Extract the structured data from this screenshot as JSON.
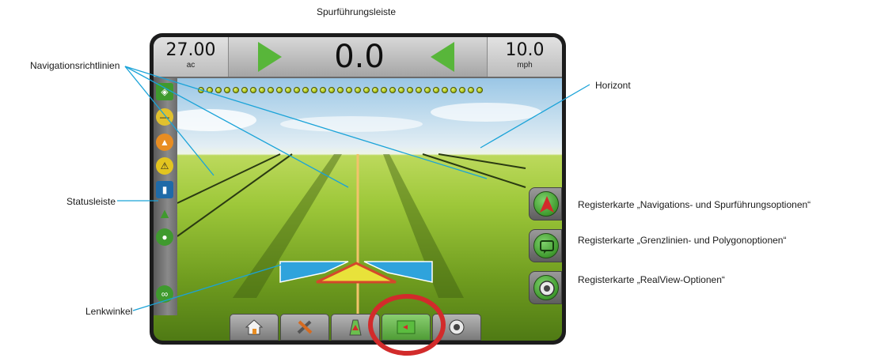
{
  "labels": {
    "guidance_bar": "Spurführungsleiste",
    "nav_lines": "Navigationsrichtlinien",
    "horizon": "Horizont",
    "status_bar": "Statusleiste",
    "steering_angle": "Lenkwinkel",
    "tab_guidance_opts": "Registerkarte „Navigations- und Spurführungsoptionen“",
    "tab_boundary_opts": "Registerkarte „Grenzlinien- und Polygonoptionen“",
    "tab_realview_opts": "Registerkarte „RealView-Optionen“"
  },
  "topbar": {
    "area_value": "27.00",
    "area_unit": "ac",
    "offline_distance": "0.0",
    "speed_value": "10.0",
    "speed_unit": "mph"
  },
  "status_icons": [
    "gps-status-icon",
    "steering-status-icon",
    "bout-status-icon",
    "warning-status-icon",
    "section-status-icon",
    "vehicle-status-icon",
    "liquid-status-icon",
    "link-status-icon"
  ],
  "bottom_tabs": [
    "home-icon",
    "tools-icon",
    "vehicle-view-icon",
    "field-map-icon",
    "realview-icon"
  ],
  "colors": {
    "accent_green": "#58b63a",
    "highlight_red": "#d22b2b",
    "leader_blue": "#1aa3d8"
  }
}
